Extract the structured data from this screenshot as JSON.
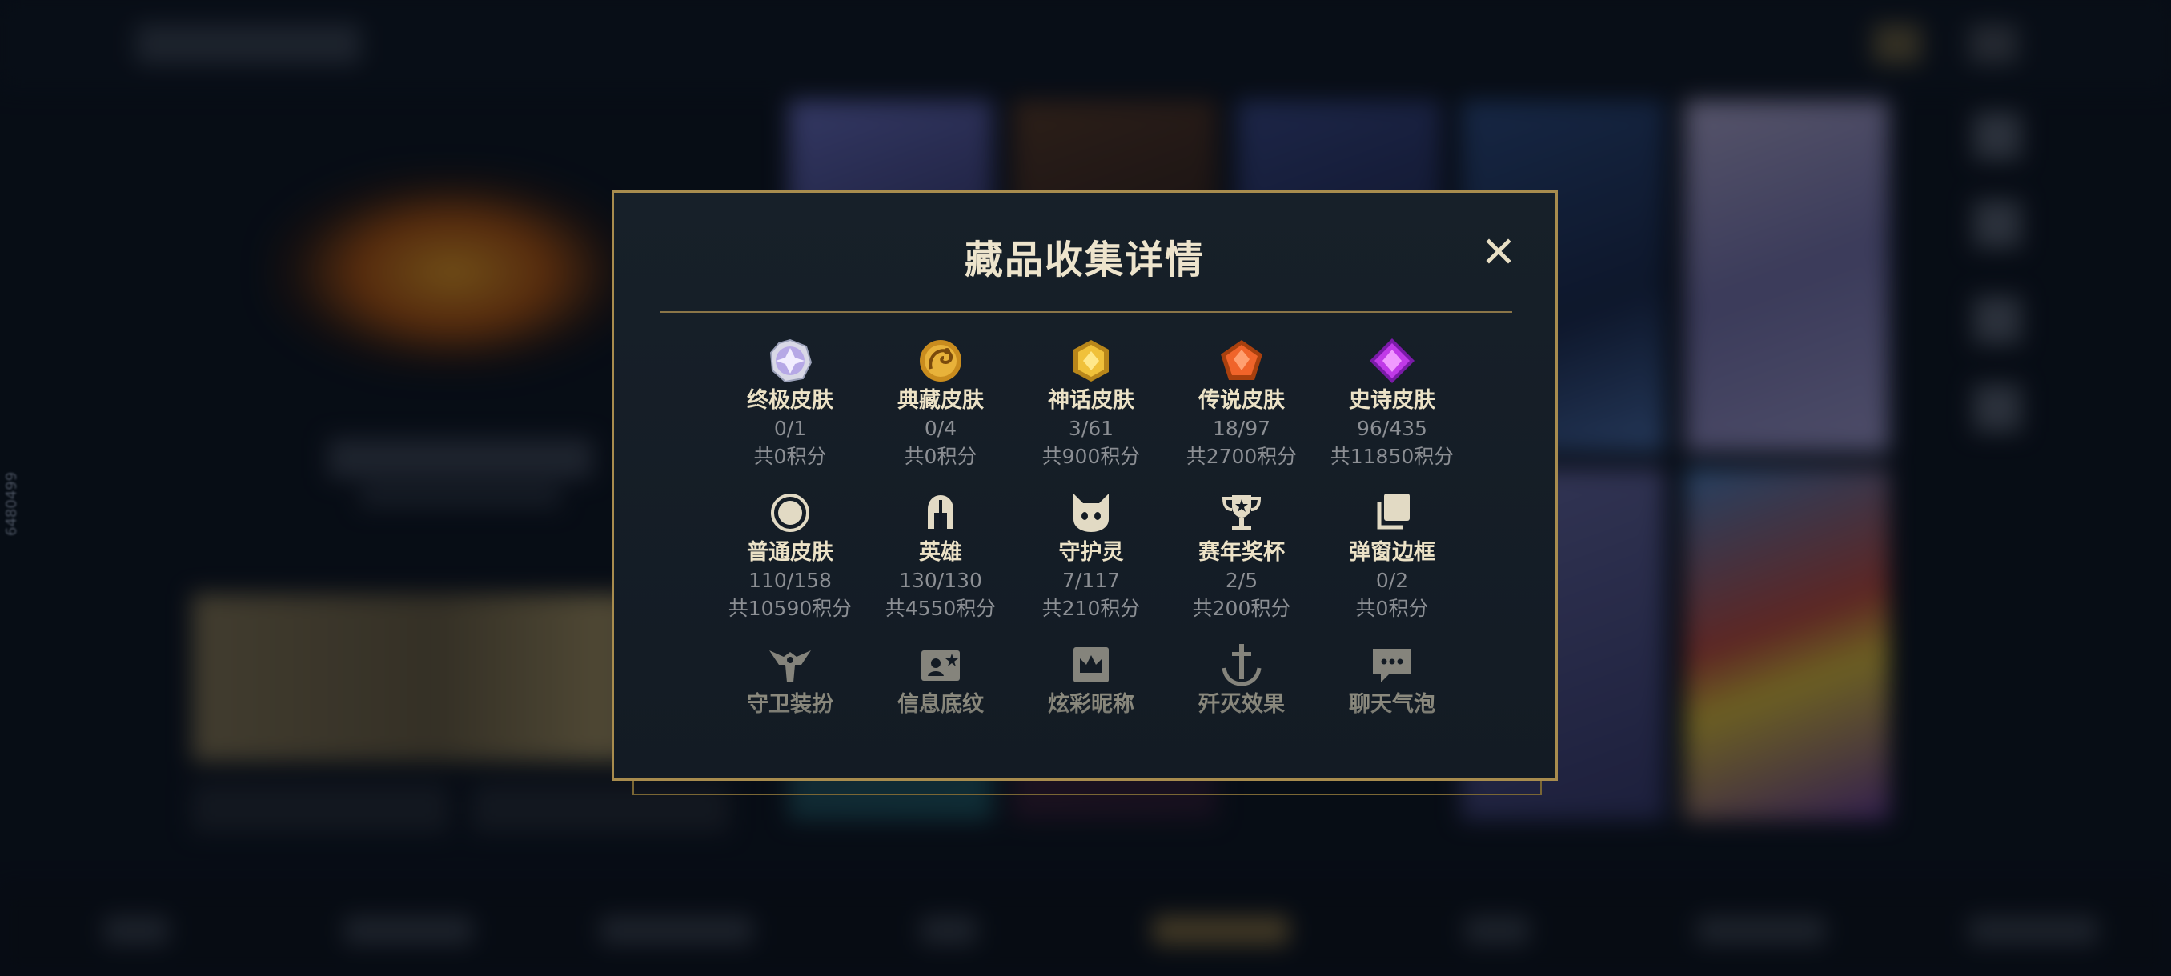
{
  "modal": {
    "title": "藏品收集详情",
    "close_icon": "close-icon",
    "accent_color": "#a88c4e"
  },
  "watermark": "6480499",
  "categories": [
    {
      "key": "ultimate-skin",
      "icon": "ultimate-gem-icon",
      "label": "终极皮肤",
      "count": "0/1",
      "points": "共0积分"
    },
    {
      "key": "collection-skin",
      "icon": "dragon-gem-icon",
      "label": "典藏皮肤",
      "count": "0/4",
      "points": "共0积分"
    },
    {
      "key": "mythic-skin",
      "icon": "gold-gem-icon",
      "label": "神话皮肤",
      "count": "3/61",
      "points": "共900积分"
    },
    {
      "key": "legendary-skin",
      "icon": "orange-gem-icon",
      "label": "传说皮肤",
      "count": "18/97",
      "points": "共2700积分"
    },
    {
      "key": "epic-skin",
      "icon": "purple-gem-icon",
      "label": "史诗皮肤",
      "count": "96/435",
      "points": "共11850积分"
    },
    {
      "key": "normal-skin",
      "icon": "circle-icon",
      "label": "普通皮肤",
      "count": "110/158",
      "points": "共10590积分"
    },
    {
      "key": "hero",
      "icon": "helmet-icon",
      "label": "英雄",
      "count": "130/130",
      "points": "共4550积分"
    },
    {
      "key": "guardian",
      "icon": "guardian-spirit-icon",
      "label": "守护灵",
      "count": "7/117",
      "points": "共210积分"
    },
    {
      "key": "season-trophy",
      "icon": "trophy-icon",
      "label": "赛年奖杯",
      "count": "2/5",
      "points": "共200积分"
    },
    {
      "key": "popup-frame",
      "icon": "stacked-frames-icon",
      "label": "弹窗边框",
      "count": "0/2",
      "points": "共0积分"
    },
    {
      "key": "guard-outfit",
      "icon": "winged-guard-icon",
      "label": "守卫装扮"
    },
    {
      "key": "info-pattern",
      "icon": "profile-card-icon",
      "label": "信息底纹"
    },
    {
      "key": "colorful-nickname",
      "icon": "crown-card-icon",
      "label": "炫彩昵称"
    },
    {
      "key": "kill-effect",
      "icon": "anchor-sword-icon",
      "label": "歼灭效果"
    },
    {
      "key": "chat-bubble",
      "icon": "chat-bubble-icon",
      "label": "聊天气泡"
    }
  ]
}
